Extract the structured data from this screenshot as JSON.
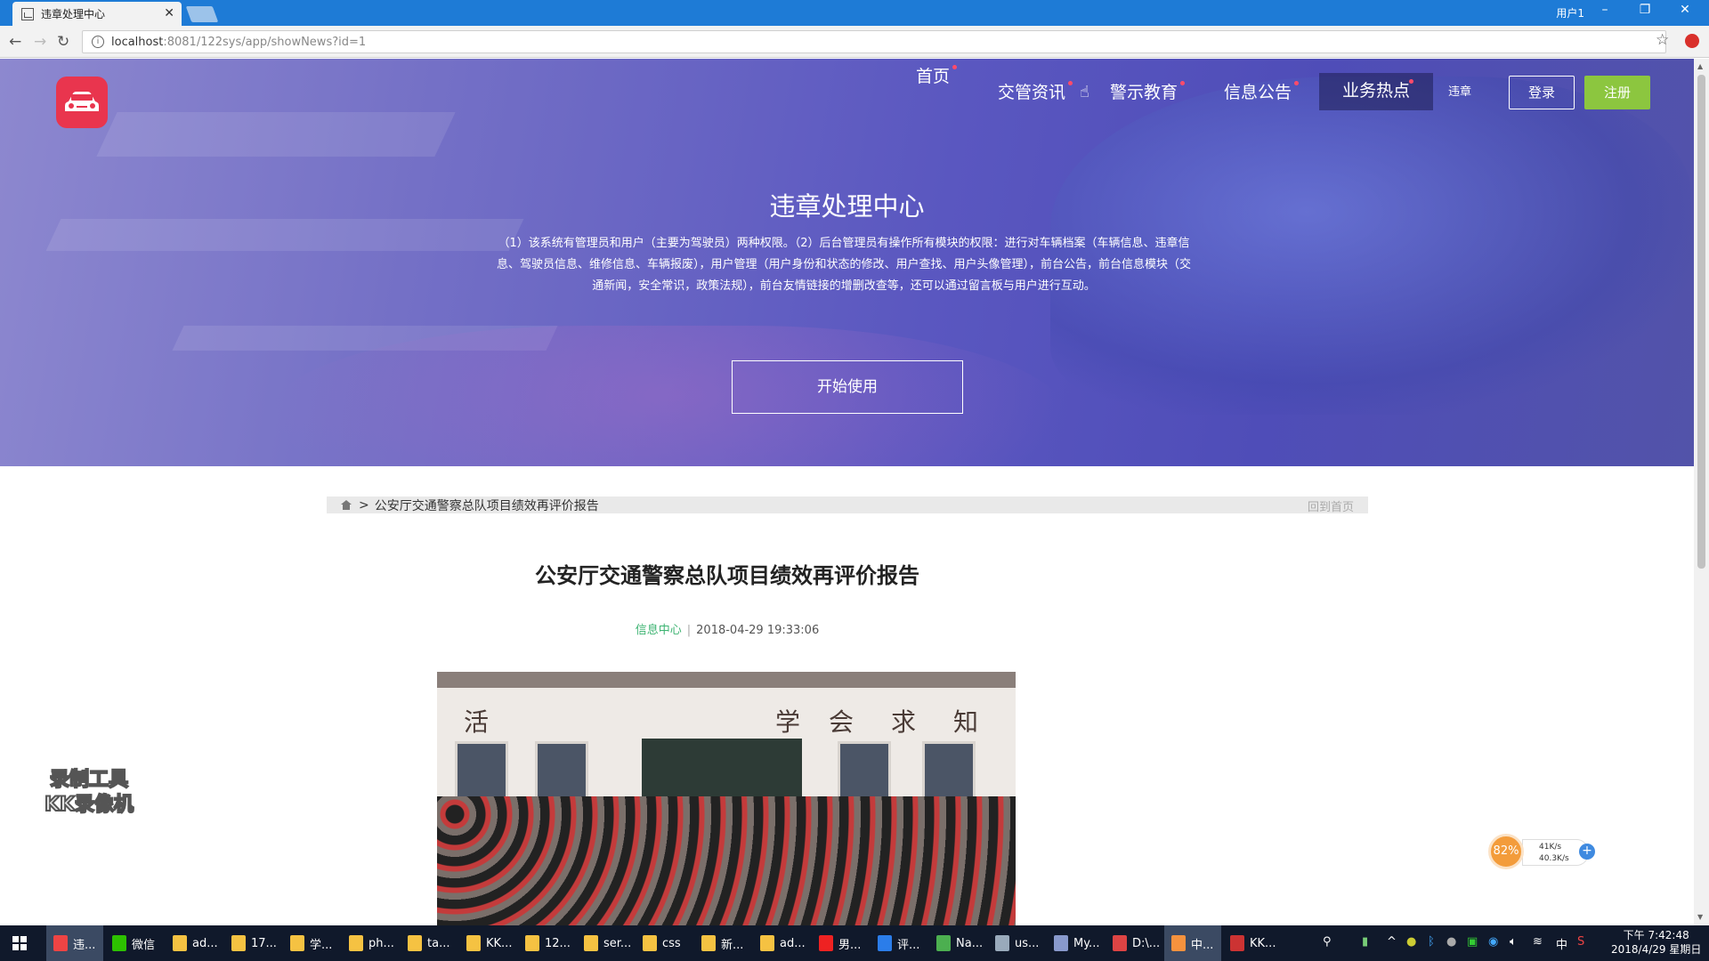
{
  "browser": {
    "tab_title": "违章处理中心",
    "window_user": "用户1",
    "url_host": "localhost",
    "url_rest": ":8081/122sys/app/showNews?id=1"
  },
  "site": {
    "nav": [
      {
        "label": "首页"
      },
      {
        "label": "交管资讯"
      },
      {
        "label": "警示教育"
      },
      {
        "label": "信息公告"
      },
      {
        "label": "业务热点"
      }
    ],
    "nav_extra": "违章",
    "login": "登录",
    "register": "注册",
    "hero_title": "违章处理中心",
    "hero_desc": "（1）该系统有管理员和用户（主要为驾驶员）两种权限。（2）后台管理员有操作所有模块的权限：进行对车辆档案（车辆信息、违章信息、驾驶员信息、维修信息、车辆报废），用户管理（用户身份和状态的修改、用户查找、用户头像管理），前台公告，前台信息模块（交通新闻，安全常识，政策法规），前台友情链接的增删改查等，还可以通过留言板与用户进行互动。",
    "start_button": "开始使用"
  },
  "breadcrumb": {
    "separator": ">",
    "current": "公安厅交通警察总队项目绩效再评价报告",
    "back_home": "回到首页"
  },
  "article": {
    "title": "公安厅交通警察总队项目绩效再评价报告",
    "source": "信息中心",
    "sep": "|",
    "datetime": "2018-04-29 19:33:06",
    "photo_chars": [
      "活",
      "学",
      "会",
      "求",
      "知"
    ]
  },
  "overlay": {
    "watermark_line1": "录制工具",
    "watermark_line2": "KK录像机",
    "cpu_percent": "82%",
    "net_up": "41K/s",
    "net_down": "40.3K/s"
  },
  "taskbar": {
    "items": [
      {
        "label": "违...",
        "color": "#e44"
      },
      {
        "label": "微信",
        "color": "#2dc100"
      },
      {
        "label": "ad...",
        "color": "#f5c242"
      },
      {
        "label": "17...",
        "color": "#f5c242"
      },
      {
        "label": "学...",
        "color": "#f5c242"
      },
      {
        "label": "ph...",
        "color": "#f5c242"
      },
      {
        "label": "ta...",
        "color": "#f5c242"
      },
      {
        "label": "KK...",
        "color": "#f5c242"
      },
      {
        "label": "12...",
        "color": "#f5c242"
      },
      {
        "label": "ser...",
        "color": "#f5c242"
      },
      {
        "label": "css",
        "color": "#f5c242"
      },
      {
        "label": "新...",
        "color": "#f5c242"
      },
      {
        "label": "ad...",
        "color": "#f5c242"
      },
      {
        "label": "男...",
        "color": "#e22"
      },
      {
        "label": "评...",
        "color": "#2b7de9"
      },
      {
        "label": "Na...",
        "color": "#4caf50"
      },
      {
        "label": "us...",
        "color": "#9ab"
      },
      {
        "label": "My...",
        "color": "#89c"
      },
      {
        "label": "D:\\...",
        "color": "#d44"
      },
      {
        "label": "中...",
        "color": "#f5923e"
      },
      {
        "label": "KK...",
        "color": "#c33"
      }
    ],
    "ime": "中",
    "time": "下午 7:42:48",
    "date": "2018/4/29 星期日"
  },
  "colors": {
    "titlebar": "#1e7bd6",
    "register_button": "#8cc63f",
    "logo": "#e9354e",
    "source_link": "#3cb371"
  }
}
